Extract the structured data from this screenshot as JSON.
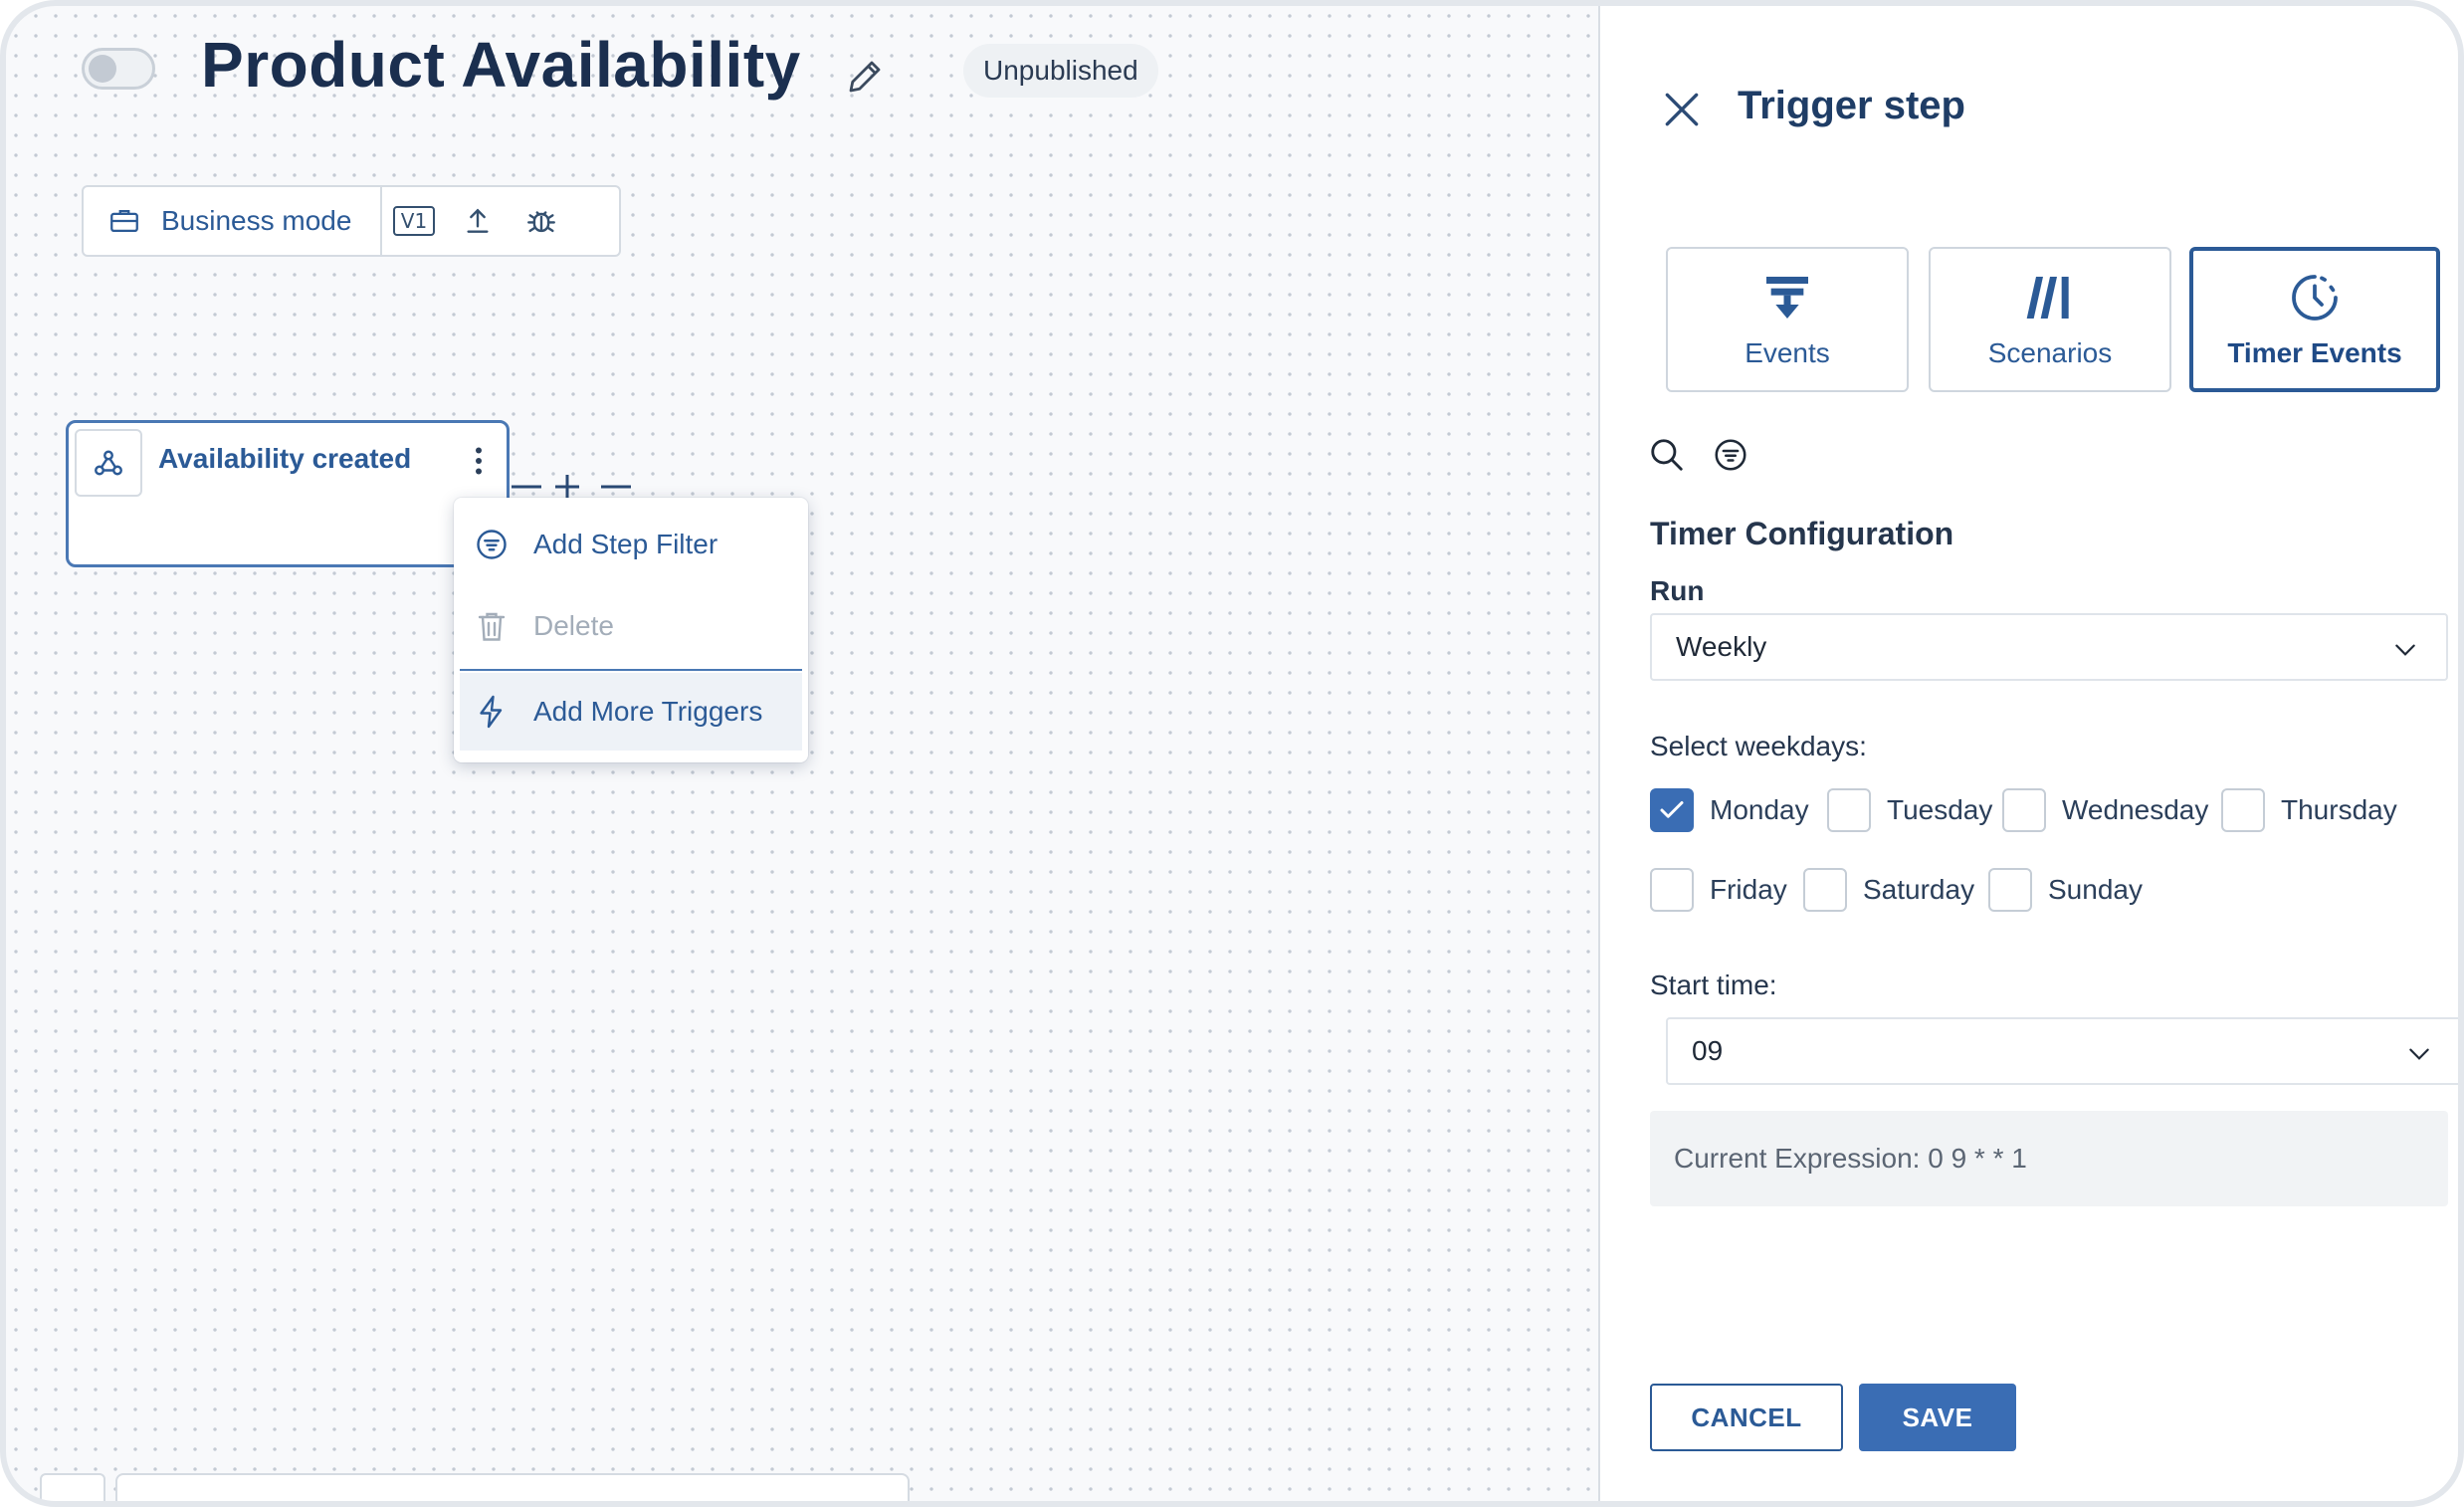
{
  "header": {
    "title": "Product Availability",
    "status": "Unpublished"
  },
  "toolbar": {
    "mode_label": "Business mode",
    "version_label": "V1"
  },
  "node": {
    "title": "Availability created"
  },
  "context_menu": {
    "items": [
      {
        "label": "Add Step Filter",
        "icon": "filter-icon",
        "enabled": true
      },
      {
        "label": "Delete",
        "icon": "trash-icon",
        "enabled": false
      },
      {
        "label": "Add More Triggers",
        "icon": "lightning-icon",
        "enabled": true
      }
    ]
  },
  "panel": {
    "title": "Trigger step",
    "tabs": [
      {
        "label": "Events",
        "icon": "events-icon",
        "selected": false
      },
      {
        "label": "Scenarios",
        "icon": "scenarios-icon",
        "selected": false
      },
      {
        "label": "Timer Events",
        "icon": "clock-icon",
        "selected": true
      }
    ],
    "section_title": "Timer Configuration",
    "run_label": "Run",
    "run_value": "Weekly",
    "weekdays_label": "Select weekdays:",
    "weekdays": [
      {
        "label": "Monday",
        "checked": true
      },
      {
        "label": "Tuesday",
        "checked": false
      },
      {
        "label": "Wednesday",
        "checked": false
      },
      {
        "label": "Thursday",
        "checked": false
      },
      {
        "label": "Friday",
        "checked": false
      },
      {
        "label": "Saturday",
        "checked": false
      },
      {
        "label": "Sunday",
        "checked": false
      }
    ],
    "start_time_label": "Start time:",
    "start_time_value": "09",
    "expression": "Current Expression: 0 9 * * 1",
    "cancel_label": "CANCEL",
    "save_label": "SAVE"
  },
  "colors": {
    "accent": "#3a6db4",
    "primary_text": "#2b5a96",
    "title_text": "#1b2f4f"
  }
}
